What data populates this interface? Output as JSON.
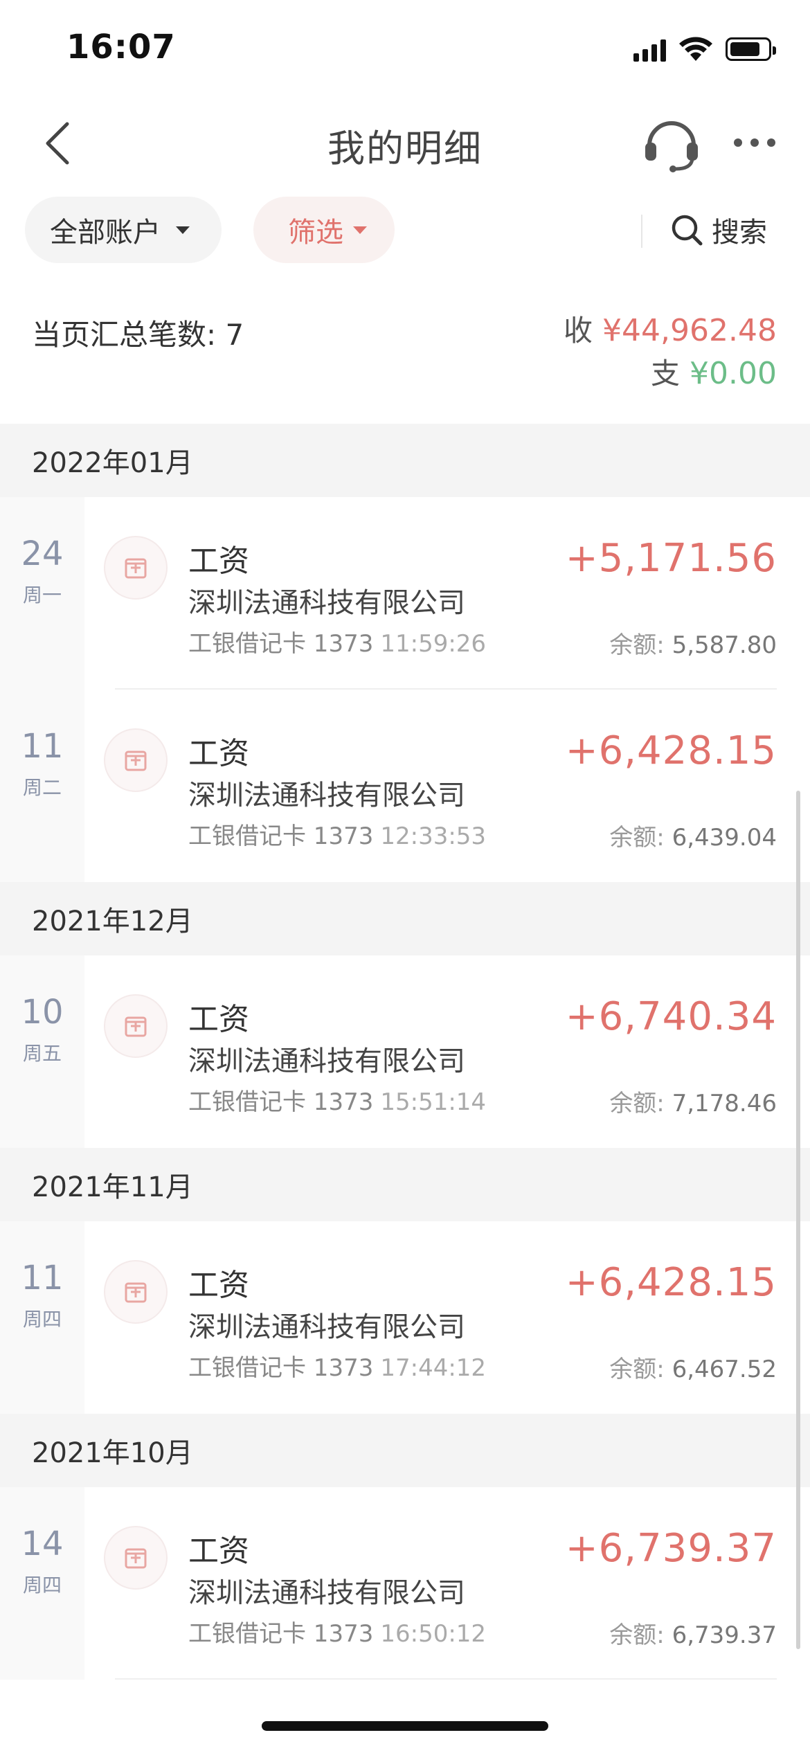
{
  "status_bar": {
    "time": "16:07"
  },
  "nav": {
    "title": "我的明细"
  },
  "filters": {
    "accounts_label": "全部账户",
    "filter_label": "筛选",
    "search_label": "搜索"
  },
  "summary": {
    "count_label": "当页汇总笔数: 7",
    "income_label": "收",
    "income_amount": "¥44,962.48",
    "expense_label": "支",
    "expense_amount": "¥0.00"
  },
  "colors": {
    "income": "#e0726c",
    "expense": "#6cbd88",
    "date_text": "#8a93a8"
  },
  "months": [
    {
      "label": "2022年01月",
      "entries": [
        {
          "day": "24",
          "weekday": "周一",
          "title": "工资",
          "company": "深圳法通科技有限公司",
          "card": "工银借记卡 1373",
          "time": "11:59:26",
          "amount": "+5,171.56",
          "balance_label": "余额:",
          "balance": "5,587.80"
        },
        {
          "day": "11",
          "weekday": "周二",
          "title": "工资",
          "company": "深圳法通科技有限公司",
          "card": "工银借记卡 1373",
          "time": "12:33:53",
          "amount": "+6,428.15",
          "balance_label": "余额:",
          "balance": "6,439.04"
        }
      ]
    },
    {
      "label": "2021年12月",
      "entries": [
        {
          "day": "10",
          "weekday": "周五",
          "title": "工资",
          "company": "深圳法通科技有限公司",
          "card": "工银借记卡 1373",
          "time": "15:51:14",
          "amount": "+6,740.34",
          "balance_label": "余额:",
          "balance": "7,178.46"
        }
      ]
    },
    {
      "label": "2021年11月",
      "entries": [
        {
          "day": "11",
          "weekday": "周四",
          "title": "工资",
          "company": "深圳法通科技有限公司",
          "card": "工银借记卡 1373",
          "time": "17:44:12",
          "amount": "+6,428.15",
          "balance_label": "余额:",
          "balance": "6,467.52"
        }
      ]
    },
    {
      "label": "2021年10月",
      "entries": [
        {
          "day": "14",
          "weekday": "周四",
          "title": "工资",
          "company": "深圳法通科技有限公司",
          "card": "工银借记卡 1373",
          "time": "16:50:12",
          "amount": "+6,739.37",
          "balance_label": "余额:",
          "balance": "6,739.37"
        }
      ]
    }
  ]
}
